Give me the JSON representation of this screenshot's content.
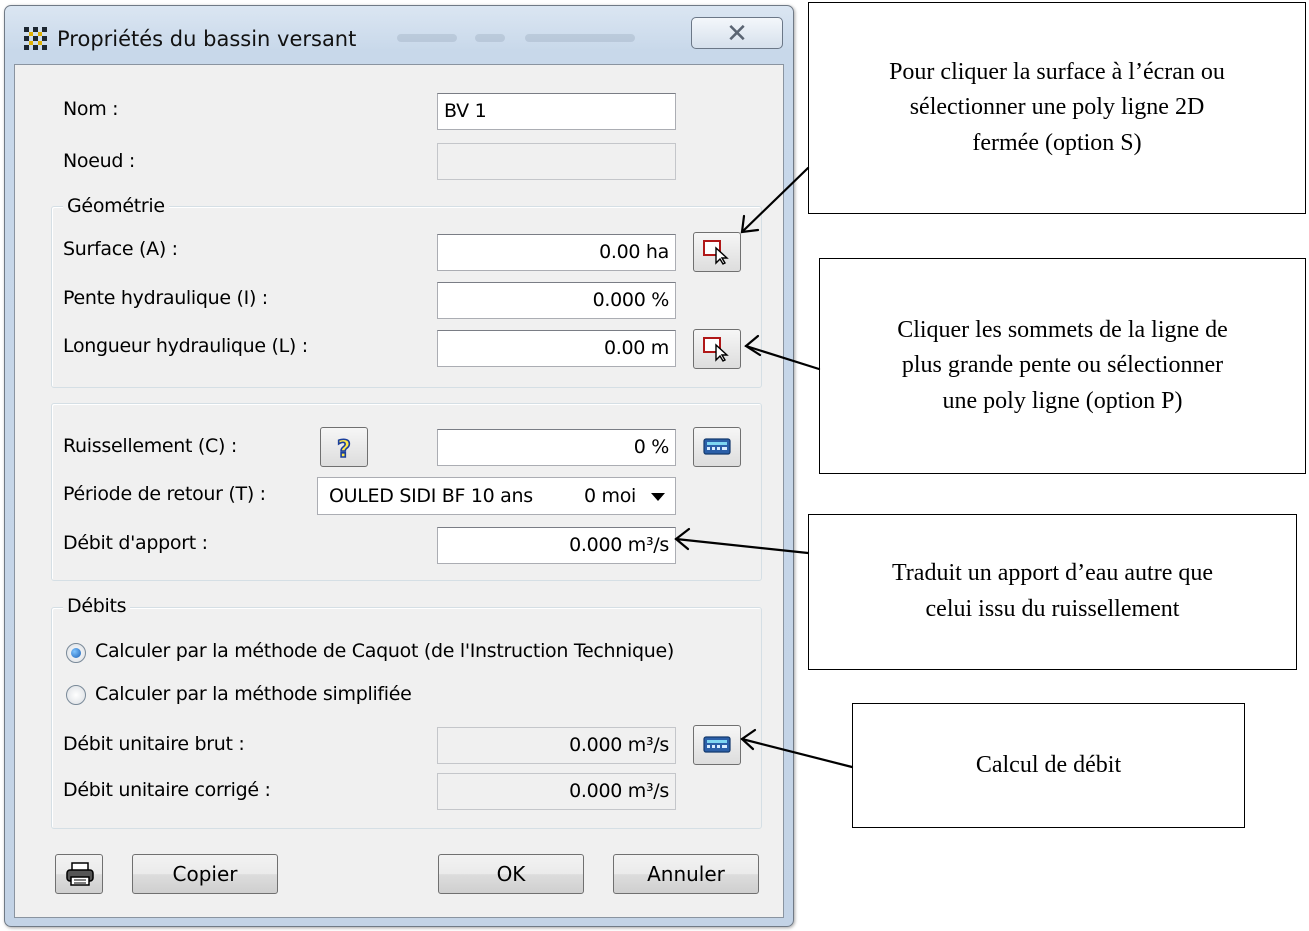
{
  "window": {
    "title": "Propriétés du bassin versant",
    "close_glyph": "✕"
  },
  "fields": {
    "nom": {
      "label": "Nom :",
      "value": "BV 1"
    },
    "noeud": {
      "label": "Noeud :",
      "value": ""
    }
  },
  "geometrie": {
    "title": "Géométrie",
    "surface": {
      "label": "Surface (A) :",
      "value": "0.00 ha",
      "pick_icon": "pick-on-screen-icon"
    },
    "pente": {
      "label": "Pente hydraulique (I) :",
      "value": "0.000 %"
    },
    "longueur": {
      "label": "Longueur hydraulique (L) :",
      "value": "0.00 m",
      "pick_icon": "pick-on-screen-icon"
    }
  },
  "hydro": {
    "ruissellement": {
      "label": "Ruissellement (C) :",
      "value": "0 %",
      "help_icon": "question-mark-icon",
      "calc_icon": "calculator-icon"
    },
    "periode": {
      "label": "Période de retour (T) :",
      "selected": "OULED SIDI BF 10 ans",
      "selected_extra": "0 moi"
    },
    "apport": {
      "label": "Débit d'apport :",
      "value": "0.000 m³/s"
    }
  },
  "debits": {
    "title": "Débits",
    "radio_caquot": {
      "label": "Calculer par la méthode de Caquot (de l'Instruction Technique)",
      "checked": true
    },
    "radio_simplifiee": {
      "label": "Calculer par la méthode simplifiée",
      "checked": false
    },
    "brut": {
      "label": "Débit unitaire brut :",
      "value": "0.000 m³/s",
      "calc_icon": "calculator-icon"
    },
    "corrige": {
      "label": "Débit unitaire corrigé :",
      "value": "0.000 m³/s"
    }
  },
  "buttons": {
    "print_icon": "printer-icon",
    "copier": "Copier",
    "ok": "OK",
    "annuler": "Annuler"
  },
  "callouts": {
    "surface": [
      "Pour cliquer la surface à l’écran ou",
      "sélectionner une poly ligne 2D",
      "fermée (option S)"
    ],
    "longueur": [
      "Cliquer les sommets de la ligne de",
      "plus grande pente ou sélectionner",
      "une poly ligne (option P)"
    ],
    "apport": [
      "Traduit un apport d’eau autre que",
      "celui issu du ruissellement"
    ],
    "calcul": [
      "Calcul de débit"
    ]
  },
  "colors": {
    "titlebar": "#c8d8ea",
    "client": "#f0f0f0",
    "radio_checked": "#1a5fb4"
  }
}
